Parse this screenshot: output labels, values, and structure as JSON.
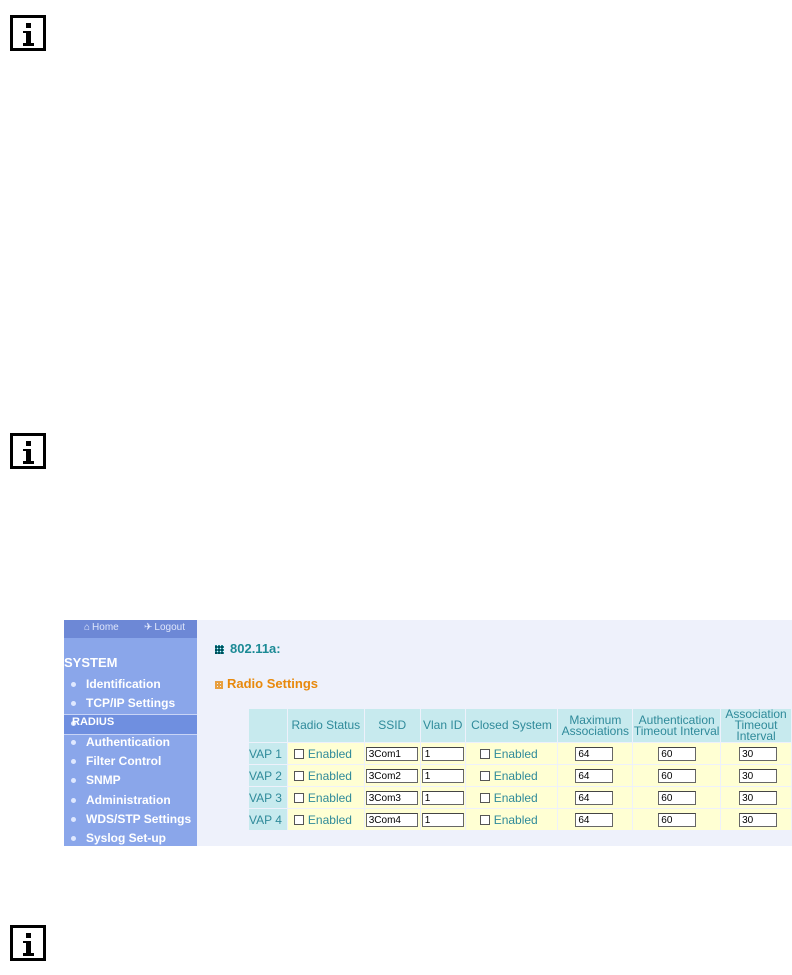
{
  "sidebar": {
    "nav": {
      "home": "Home",
      "logout": "Logout"
    },
    "heading": "SYSTEM",
    "items": [
      {
        "label": "Identification",
        "active": false
      },
      {
        "label": "TCP/IP Settings",
        "active": false
      },
      {
        "label": "RADIUS",
        "active": true
      },
      {
        "label": "Authentication",
        "active": false
      },
      {
        "label": "Filter Control",
        "active": false
      },
      {
        "label": "SNMP",
        "active": false
      },
      {
        "label": "Administration",
        "active": false
      },
      {
        "label": "WDS/STP Settings",
        "active": false
      },
      {
        "label": "Syslog Set-up",
        "active": false
      }
    ]
  },
  "main": {
    "title": "802.11a:",
    "section": "Radio Settings",
    "table": {
      "headers": [
        "",
        "Radio Status",
        "SSID",
        "Vlan ID",
        "Closed System",
        "Maximum Associations",
        "Authentication Timeout Interval",
        "Association Timeout Interval"
      ],
      "rows": [
        {
          "vap": "VAP 1",
          "radio_status": "Enabled",
          "ssid": "3Com1",
          "vlan": "1",
          "closed_system": "Enabled",
          "max_assoc": "64",
          "auth_timeout": "60",
          "assoc_timeout": "30"
        },
        {
          "vap": "VAP 2",
          "radio_status": "Enabled",
          "ssid": "3Com2",
          "vlan": "1",
          "closed_system": "Enabled",
          "max_assoc": "64",
          "auth_timeout": "60",
          "assoc_timeout": "30"
        },
        {
          "vap": "VAP 3",
          "radio_status": "Enabled",
          "ssid": "3Com3",
          "vlan": "1",
          "closed_system": "Enabled",
          "max_assoc": "64",
          "auth_timeout": "60",
          "assoc_timeout": "30"
        },
        {
          "vap": "VAP 4",
          "radio_status": "Enabled",
          "ssid": "3Com4",
          "vlan": "1",
          "closed_system": "Enabled",
          "max_assoc": "64",
          "auth_timeout": "60",
          "assoc_timeout": "30"
        }
      ]
    }
  },
  "colors": {
    "sidebar": "#8aa6ea",
    "accent_teal": "#1b8a95",
    "accent_orange": "#e8890c",
    "header_cell": "#c7eaee",
    "data_cell": "#ffffd3"
  }
}
